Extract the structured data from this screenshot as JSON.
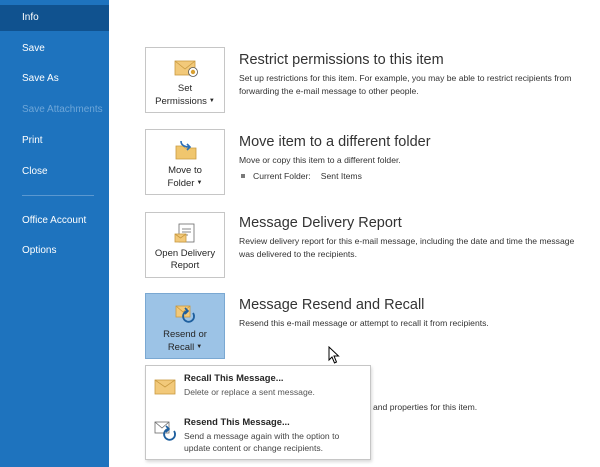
{
  "sidebar": {
    "items": [
      {
        "label": "Info"
      },
      {
        "label": "Save"
      },
      {
        "label": "Save As"
      },
      {
        "label": "Save Attachments"
      },
      {
        "label": "Print"
      },
      {
        "label": "Close"
      },
      {
        "label": "Office Account"
      },
      {
        "label": "Options"
      }
    ]
  },
  "sections": {
    "permissions": {
      "button": {
        "line1": "Set",
        "line2": "Permissions"
      },
      "title": "Restrict permissions to this item",
      "desc": "Set up restrictions for this item. For example, you may be able to restrict recipients from forwarding the e-mail message to other people."
    },
    "move": {
      "button": {
        "line1": "Move to",
        "line2": "Folder"
      },
      "title": "Move item to a different folder",
      "desc": "Move or copy this item to a different folder.",
      "folder_label": "Current Folder:",
      "folder_value": "Sent Items"
    },
    "delivery": {
      "button": {
        "line1": "Open Delivery",
        "line2": "Report"
      },
      "title": "Message Delivery Report",
      "desc": "Review delivery report for this e-mail message, including the date and time the message was delivered to the recipients."
    },
    "resend": {
      "button": {
        "line1": "Resend or",
        "line2": "Recall"
      },
      "title": "Message Resend and Recall",
      "desc": "Resend this e-mail message or attempt to recall it from recipients."
    },
    "properties_partial": "and properties for this item."
  },
  "dropdown": {
    "recall": {
      "title": "Recall This Message...",
      "desc": "Delete or replace a sent message."
    },
    "resend": {
      "title": "Resend This Message...",
      "desc": "Send a message again with the option to update content or change recipients."
    }
  },
  "colors": {
    "sidebar": "#1e73be",
    "sidebar_active": "#10528f",
    "pressed_tile": "#9cc3e6"
  }
}
